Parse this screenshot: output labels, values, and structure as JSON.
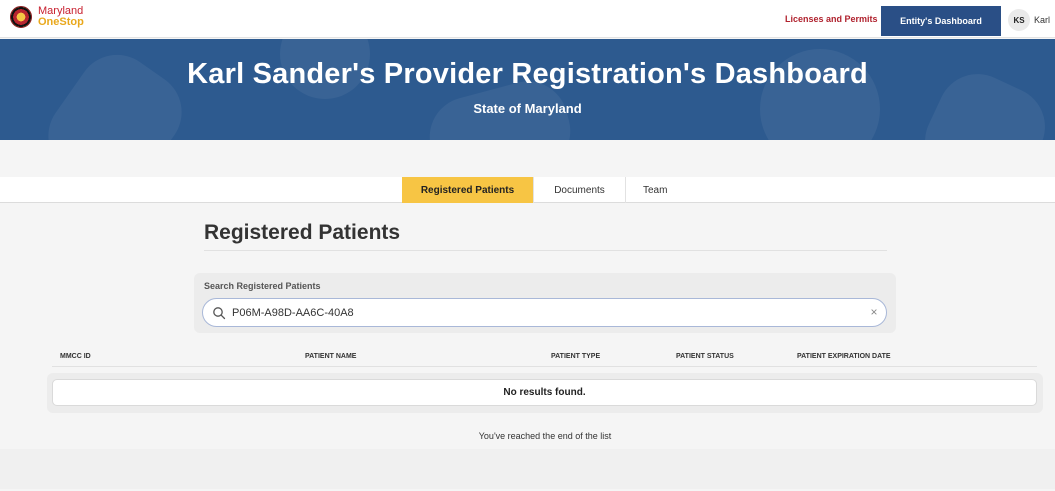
{
  "brand": {
    "line1": "Maryland",
    "line2": "OneStop"
  },
  "topnav": {
    "licenses_label": "Licenses and Permits",
    "entity_label": "Entity's Dashboard",
    "user_initials": "KS",
    "user_name": "Karl"
  },
  "banner": {
    "title": "Karl Sander's Provider Registration's Dashboard",
    "subtitle": "State of Maryland"
  },
  "tabs": [
    {
      "label": "Registered Patients",
      "active": true
    },
    {
      "label": "Documents",
      "active": false
    },
    {
      "label": "Team",
      "active": false
    }
  ],
  "main": {
    "title": "Registered Patients",
    "search": {
      "label": "Search Registered Patients",
      "value": "P06M-A98D-AA6C-40A8",
      "clear_glyph": "×"
    },
    "table": {
      "columns": [
        "MMCC ID",
        "PATIENT NAME",
        "PATIENT TYPE",
        "PATIENT STATUS",
        "PATIENT EXPIRATION DATE"
      ],
      "empty_message": "No results found."
    },
    "end_of_list": "You've reached the end of the list"
  },
  "colors": {
    "banner": "#2d5a8f",
    "active_tab": "#f7c544",
    "entity_button": "#2a4f86",
    "licenses_link": "#b0222e"
  },
  "icons": [
    "maryland-seal-icon",
    "search-icon",
    "clear-icon"
  ]
}
